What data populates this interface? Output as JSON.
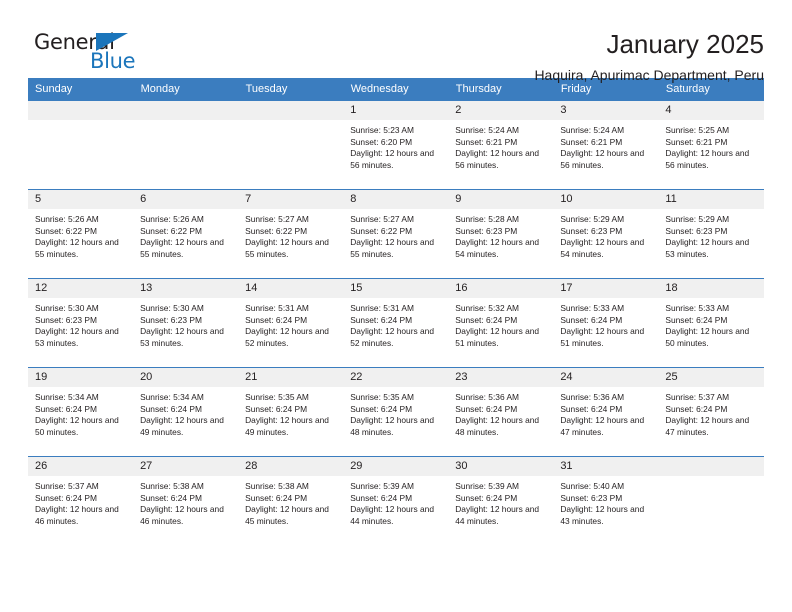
{
  "logo": {
    "word_top": "General",
    "word_bottom": "Blue",
    "accent_color": "#1b75bb"
  },
  "header": {
    "title": "January 2025",
    "subtitle": "Haquira, Apurimac Department, Peru"
  },
  "calendar": {
    "header_color": "#3b7dbf",
    "daynum_bg": "#f0f0f0",
    "weekday_headers": [
      "Sunday",
      "Monday",
      "Tuesday",
      "Wednesday",
      "Thursday",
      "Friday",
      "Saturday"
    ],
    "weeks": [
      [
        {
          "day": "",
          "empty": true
        },
        {
          "day": "",
          "empty": true
        },
        {
          "day": "",
          "empty": true
        },
        {
          "day": "1",
          "sunrise": "Sunrise: 5:23 AM",
          "sunset": "Sunset: 6:20 PM",
          "daylight": "Daylight: 12 hours and 56 minutes."
        },
        {
          "day": "2",
          "sunrise": "Sunrise: 5:24 AM",
          "sunset": "Sunset: 6:21 PM",
          "daylight": "Daylight: 12 hours and 56 minutes."
        },
        {
          "day": "3",
          "sunrise": "Sunrise: 5:24 AM",
          "sunset": "Sunset: 6:21 PM",
          "daylight": "Daylight: 12 hours and 56 minutes."
        },
        {
          "day": "4",
          "sunrise": "Sunrise: 5:25 AM",
          "sunset": "Sunset: 6:21 PM",
          "daylight": "Daylight: 12 hours and 56 minutes."
        }
      ],
      [
        {
          "day": "5",
          "sunrise": "Sunrise: 5:26 AM",
          "sunset": "Sunset: 6:22 PM",
          "daylight": "Daylight: 12 hours and 55 minutes."
        },
        {
          "day": "6",
          "sunrise": "Sunrise: 5:26 AM",
          "sunset": "Sunset: 6:22 PM",
          "daylight": "Daylight: 12 hours and 55 minutes."
        },
        {
          "day": "7",
          "sunrise": "Sunrise: 5:27 AM",
          "sunset": "Sunset: 6:22 PM",
          "daylight": "Daylight: 12 hours and 55 minutes."
        },
        {
          "day": "8",
          "sunrise": "Sunrise: 5:27 AM",
          "sunset": "Sunset: 6:22 PM",
          "daylight": "Daylight: 12 hours and 55 minutes."
        },
        {
          "day": "9",
          "sunrise": "Sunrise: 5:28 AM",
          "sunset": "Sunset: 6:23 PM",
          "daylight": "Daylight: 12 hours and 54 minutes."
        },
        {
          "day": "10",
          "sunrise": "Sunrise: 5:29 AM",
          "sunset": "Sunset: 6:23 PM",
          "daylight": "Daylight: 12 hours and 54 minutes."
        },
        {
          "day": "11",
          "sunrise": "Sunrise: 5:29 AM",
          "sunset": "Sunset: 6:23 PM",
          "daylight": "Daylight: 12 hours and 53 minutes."
        }
      ],
      [
        {
          "day": "12",
          "sunrise": "Sunrise: 5:30 AM",
          "sunset": "Sunset: 6:23 PM",
          "daylight": "Daylight: 12 hours and 53 minutes."
        },
        {
          "day": "13",
          "sunrise": "Sunrise: 5:30 AM",
          "sunset": "Sunset: 6:23 PM",
          "daylight": "Daylight: 12 hours and 53 minutes."
        },
        {
          "day": "14",
          "sunrise": "Sunrise: 5:31 AM",
          "sunset": "Sunset: 6:24 PM",
          "daylight": "Daylight: 12 hours and 52 minutes."
        },
        {
          "day": "15",
          "sunrise": "Sunrise: 5:31 AM",
          "sunset": "Sunset: 6:24 PM",
          "daylight": "Daylight: 12 hours and 52 minutes."
        },
        {
          "day": "16",
          "sunrise": "Sunrise: 5:32 AM",
          "sunset": "Sunset: 6:24 PM",
          "daylight": "Daylight: 12 hours and 51 minutes."
        },
        {
          "day": "17",
          "sunrise": "Sunrise: 5:33 AM",
          "sunset": "Sunset: 6:24 PM",
          "daylight": "Daylight: 12 hours and 51 minutes."
        },
        {
          "day": "18",
          "sunrise": "Sunrise: 5:33 AM",
          "sunset": "Sunset: 6:24 PM",
          "daylight": "Daylight: 12 hours and 50 minutes."
        }
      ],
      [
        {
          "day": "19",
          "sunrise": "Sunrise: 5:34 AM",
          "sunset": "Sunset: 6:24 PM",
          "daylight": "Daylight: 12 hours and 50 minutes."
        },
        {
          "day": "20",
          "sunrise": "Sunrise: 5:34 AM",
          "sunset": "Sunset: 6:24 PM",
          "daylight": "Daylight: 12 hours and 49 minutes."
        },
        {
          "day": "21",
          "sunrise": "Sunrise: 5:35 AM",
          "sunset": "Sunset: 6:24 PM",
          "daylight": "Daylight: 12 hours and 49 minutes."
        },
        {
          "day": "22",
          "sunrise": "Sunrise: 5:35 AM",
          "sunset": "Sunset: 6:24 PM",
          "daylight": "Daylight: 12 hours and 48 minutes."
        },
        {
          "day": "23",
          "sunrise": "Sunrise: 5:36 AM",
          "sunset": "Sunset: 6:24 PM",
          "daylight": "Daylight: 12 hours and 48 minutes."
        },
        {
          "day": "24",
          "sunrise": "Sunrise: 5:36 AM",
          "sunset": "Sunset: 6:24 PM",
          "daylight": "Daylight: 12 hours and 47 minutes."
        },
        {
          "day": "25",
          "sunrise": "Sunrise: 5:37 AM",
          "sunset": "Sunset: 6:24 PM",
          "daylight": "Daylight: 12 hours and 47 minutes."
        }
      ],
      [
        {
          "day": "26",
          "sunrise": "Sunrise: 5:37 AM",
          "sunset": "Sunset: 6:24 PM",
          "daylight": "Daylight: 12 hours and 46 minutes."
        },
        {
          "day": "27",
          "sunrise": "Sunrise: 5:38 AM",
          "sunset": "Sunset: 6:24 PM",
          "daylight": "Daylight: 12 hours and 46 minutes."
        },
        {
          "day": "28",
          "sunrise": "Sunrise: 5:38 AM",
          "sunset": "Sunset: 6:24 PM",
          "daylight": "Daylight: 12 hours and 45 minutes."
        },
        {
          "day": "29",
          "sunrise": "Sunrise: 5:39 AM",
          "sunset": "Sunset: 6:24 PM",
          "daylight": "Daylight: 12 hours and 44 minutes."
        },
        {
          "day": "30",
          "sunrise": "Sunrise: 5:39 AM",
          "sunset": "Sunset: 6:24 PM",
          "daylight": "Daylight: 12 hours and 44 minutes."
        },
        {
          "day": "31",
          "sunrise": "Sunrise: 5:40 AM",
          "sunset": "Sunset: 6:23 PM",
          "daylight": "Daylight: 12 hours and 43 minutes."
        },
        {
          "day": "",
          "empty": true
        }
      ]
    ]
  }
}
